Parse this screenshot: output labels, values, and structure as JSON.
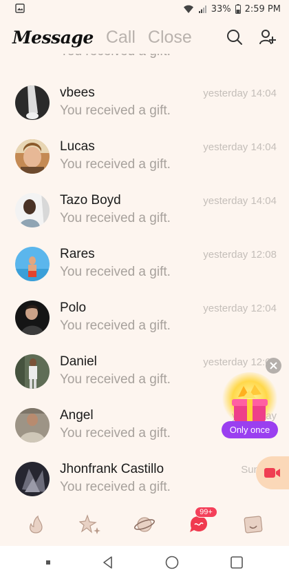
{
  "status_bar": {
    "battery": "33%",
    "time": "2:59 PM"
  },
  "header": {
    "tabs": [
      {
        "label": "Message",
        "active": true
      },
      {
        "label": "Call",
        "active": false
      },
      {
        "label": "Close",
        "active": false
      }
    ]
  },
  "partial_row": {
    "preview": "You received a gift."
  },
  "conversations": [
    {
      "name": "vbees",
      "preview": "You received a gift.",
      "time": "yesterday 14:04"
    },
    {
      "name": "Lucas",
      "preview": "You received a gift.",
      "time": "yesterday 14:04"
    },
    {
      "name": "Tazo Boyd",
      "preview": "You received a gift.",
      "time": "yesterday 14:04"
    },
    {
      "name": "Rares",
      "preview": "You received a gift.",
      "time": "yesterday 12:08"
    },
    {
      "name": "Polo",
      "preview": "You received a gift.",
      "time": "yesterday 12:04"
    },
    {
      "name": "Daniel",
      "preview": "You received a gift.",
      "time": "yesterday 12:00"
    },
    {
      "name": "Angel",
      "preview": "You received a gift.",
      "time": "yesterday"
    },
    {
      "name": "Jhonfrank Castillo",
      "preview": "You received a gift.",
      "time": "Sun. 16"
    }
  ],
  "gift_promo": {
    "label": "Only once"
  },
  "bottom_nav": {
    "items": [
      {
        "icon": "flame-icon"
      },
      {
        "icon": "sparkle-star-icon"
      },
      {
        "icon": "planet-icon"
      },
      {
        "icon": "chat-bubble-icon",
        "badge": "99+"
      },
      {
        "icon": "profile-card-icon"
      }
    ]
  },
  "colors": {
    "accent_purple": "#9a3ff0",
    "badge_red": "#f4405a",
    "background": "#fdf5ef"
  }
}
